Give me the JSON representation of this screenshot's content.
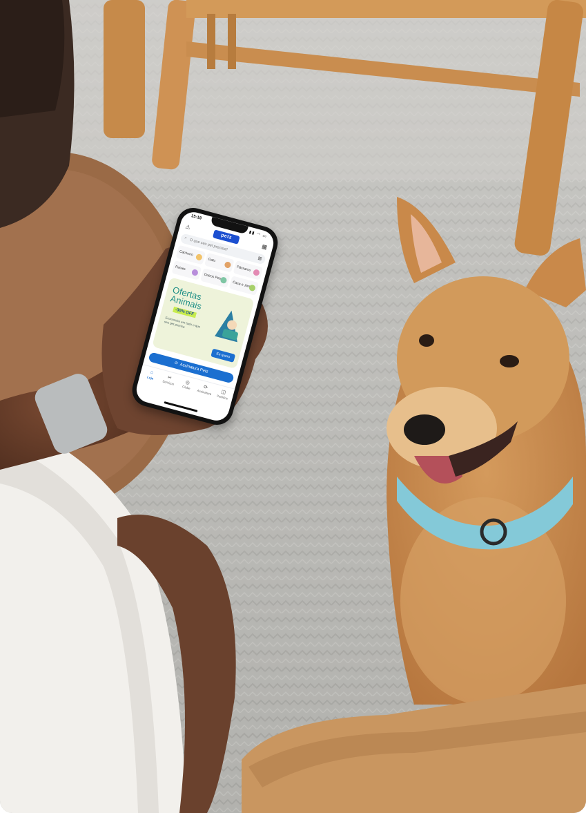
{
  "phone": {
    "status_time": "15:18",
    "status_icons": "▮▮ ◠ ▭",
    "app": {
      "logo_text": "petz",
      "alert_icon": "warning-icon",
      "cart_icon": "cart-icon"
    },
    "search": {
      "placeholder": "O que seu pet precisa?",
      "search_icon": "search-icon",
      "barcode_icon": "barcode-icon"
    },
    "categories": [
      {
        "label": "Cachorro",
        "icon": "dog-icon",
        "color": "#f2c36b"
      },
      {
        "label": "Gato",
        "icon": "cat-icon",
        "color": "#e2a266"
      },
      {
        "label": "Pássaros",
        "icon": "bird-icon",
        "color": "#e38ab3"
      },
      {
        "label": "Peixes",
        "icon": "fish-icon",
        "color": "#b88ddb"
      },
      {
        "label": "Outros Pets",
        "icon": "hamster-icon",
        "color": "#7fc6a4"
      },
      {
        "label": "Casa e Jardim",
        "icon": "plant-icon",
        "color": "#a7d06a"
      }
    ],
    "banner": {
      "title": "Ofertas Animais",
      "badge": "-30% OFF",
      "subtitle": "Economize em tudo o que seu pet precisa",
      "cta": "Eu quero"
    },
    "subscription_button": "Assinatura Petz",
    "tabs": [
      {
        "label": "Loja",
        "icon": "store-icon",
        "active": true
      },
      {
        "label": "Serviços",
        "icon": "services-icon",
        "active": false
      },
      {
        "label": "Clube",
        "icon": "club-icon",
        "active": false
      },
      {
        "label": "Assinatura",
        "icon": "refresh-icon",
        "active": false
      },
      {
        "label": "Pedidos",
        "icon": "bag-icon",
        "active": false
      }
    ]
  },
  "colors": {
    "brand_blue": "#1b6fd0",
    "banner_bg": "#eef3da",
    "banner_title": "#1f8f86",
    "badge_green": "#c8ec4e",
    "collar": "#84c9d8"
  }
}
